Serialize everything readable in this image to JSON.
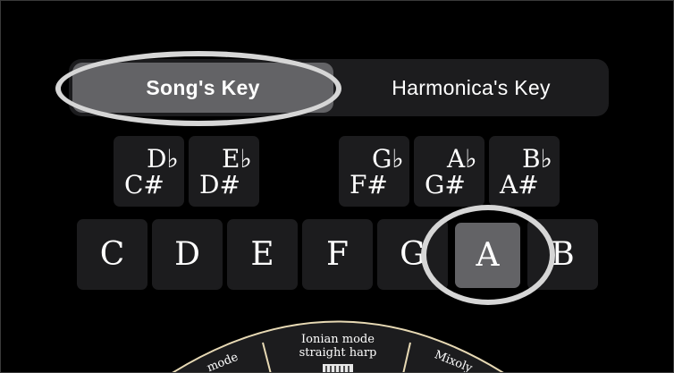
{
  "segmented": {
    "options": [
      "Song's Key",
      "Harmonica's Key"
    ],
    "selected": "Song's Key"
  },
  "accidental_keys": [
    {
      "flat": "D♭",
      "sharp": "C#"
    },
    {
      "flat": "E♭",
      "sharp": "D#"
    },
    {
      "flat": "G♭",
      "sharp": "F#"
    },
    {
      "flat": "A♭",
      "sharp": "G#"
    },
    {
      "flat": "B♭",
      "sharp": "A#"
    }
  ],
  "natural_keys": [
    "C",
    "D",
    "E",
    "F",
    "G",
    "A",
    "B"
  ],
  "selected_key": "A",
  "dial": {
    "center_title": "Ionian mode",
    "center_subtitle": "straight harp",
    "left_partial": "mode",
    "right_partial": "Mixoly"
  },
  "colors": {
    "background": "#000000",
    "control_bg": "#1c1c1e",
    "selected_bg": "#636366",
    "highlight_ring": "#d6d6d6",
    "dial_border": "#e7d9b4"
  }
}
